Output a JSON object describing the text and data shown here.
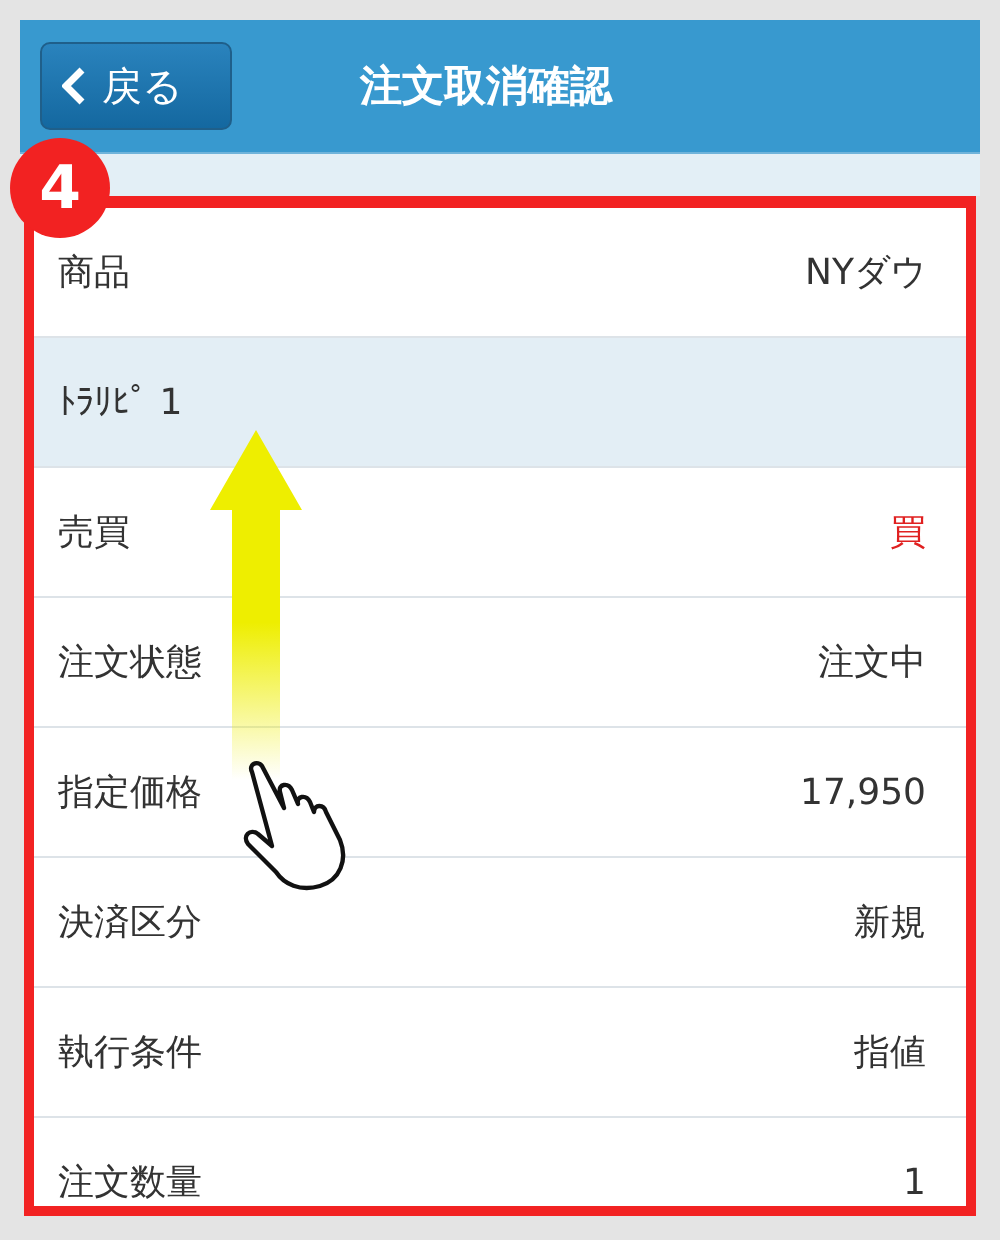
{
  "header": {
    "back_button": "戻る",
    "title": "注文取消確認"
  },
  "annotation": {
    "step": "4"
  },
  "rows": [
    {
      "kind": "field",
      "label": "商品",
      "value": "NYダウ",
      "highlight": false
    },
    {
      "kind": "section",
      "label": "ﾄﾗﾘﾋﾟ 1"
    },
    {
      "kind": "field",
      "label": "売買",
      "value": "買",
      "highlight": true
    },
    {
      "kind": "field",
      "label": "注文状態",
      "value": "注文中",
      "highlight": false
    },
    {
      "kind": "field",
      "label": "指定価格",
      "value": "17,950",
      "highlight": false
    },
    {
      "kind": "field",
      "label": "決済区分",
      "value": "新規",
      "highlight": false
    },
    {
      "kind": "field",
      "label": "執行条件",
      "value": "指値",
      "highlight": false
    },
    {
      "kind": "field",
      "label": "注文数量",
      "value": "1",
      "highlight": false
    }
  ]
}
